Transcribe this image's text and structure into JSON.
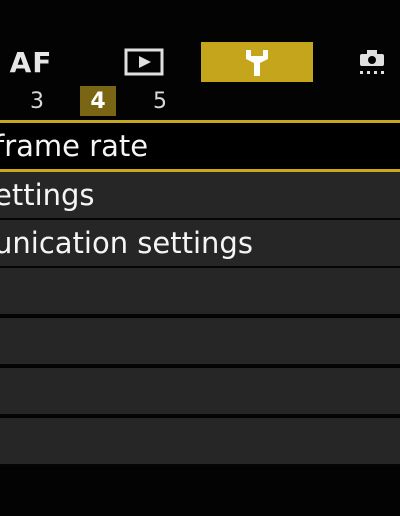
{
  "tabs": {
    "af_label": "AF",
    "icons": [
      "af-tab",
      "playback-icon",
      "wrench-icon",
      "camera-icon"
    ],
    "active_color": "#c5a51c"
  },
  "subtabs": {
    "items": [
      "3",
      "4",
      "5"
    ],
    "active": "4",
    "active_color": "#7a6514"
  },
  "menu": {
    "items": [
      "frame rate",
      "ettings",
      "unication settings",
      "",
      "",
      "",
      ""
    ],
    "selected_index": 0,
    "highlight_color": "#c7a820"
  }
}
